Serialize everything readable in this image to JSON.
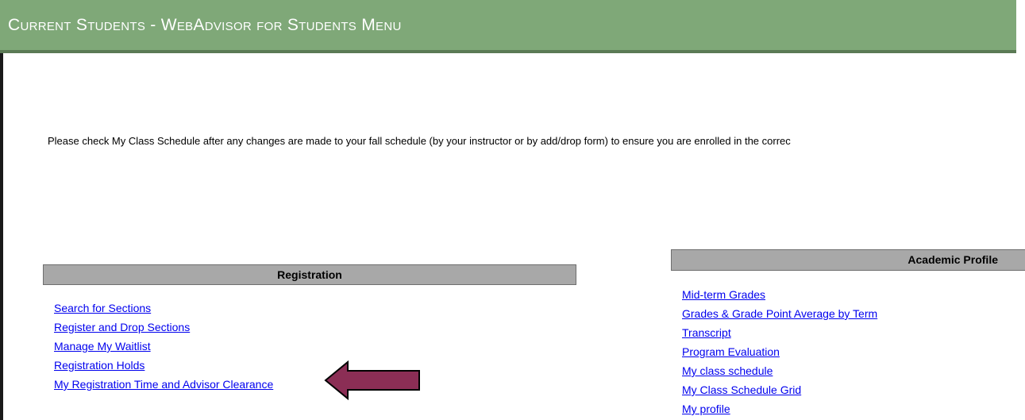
{
  "header": {
    "title": "Current Students - WebAdvisor for Students Menu"
  },
  "notice": {
    "text": "Please check My Class Schedule after any changes are made to your fall schedule (by your instructor or by add/drop form) to ensure you are enrolled in the correc"
  },
  "registration": {
    "title": "Registration",
    "links": [
      {
        "label": "Search for Sections"
      },
      {
        "label": "Register and Drop Sections"
      },
      {
        "label": "Manage My Waitlist"
      },
      {
        "label": "Registration Holds"
      },
      {
        "label": "My Registration Time and Advisor Clearance"
      }
    ]
  },
  "academic_profile": {
    "title": "Academic Profile",
    "links": [
      {
        "label": "Mid-term Grades"
      },
      {
        "label": "Grades & Grade Point Average by Term"
      },
      {
        "label": "Transcript"
      },
      {
        "label": "Program Evaluation"
      },
      {
        "label": "My class schedule"
      },
      {
        "label": "My Class Schedule Grid"
      },
      {
        "label": "My profile"
      }
    ]
  },
  "colors": {
    "header_bg": "#7fa878",
    "section_bg": "#a8a8a8",
    "link": "#0000ee",
    "arrow": "#8b2e55"
  },
  "icons": {
    "annotation_arrow": "left-arrow-icon"
  }
}
